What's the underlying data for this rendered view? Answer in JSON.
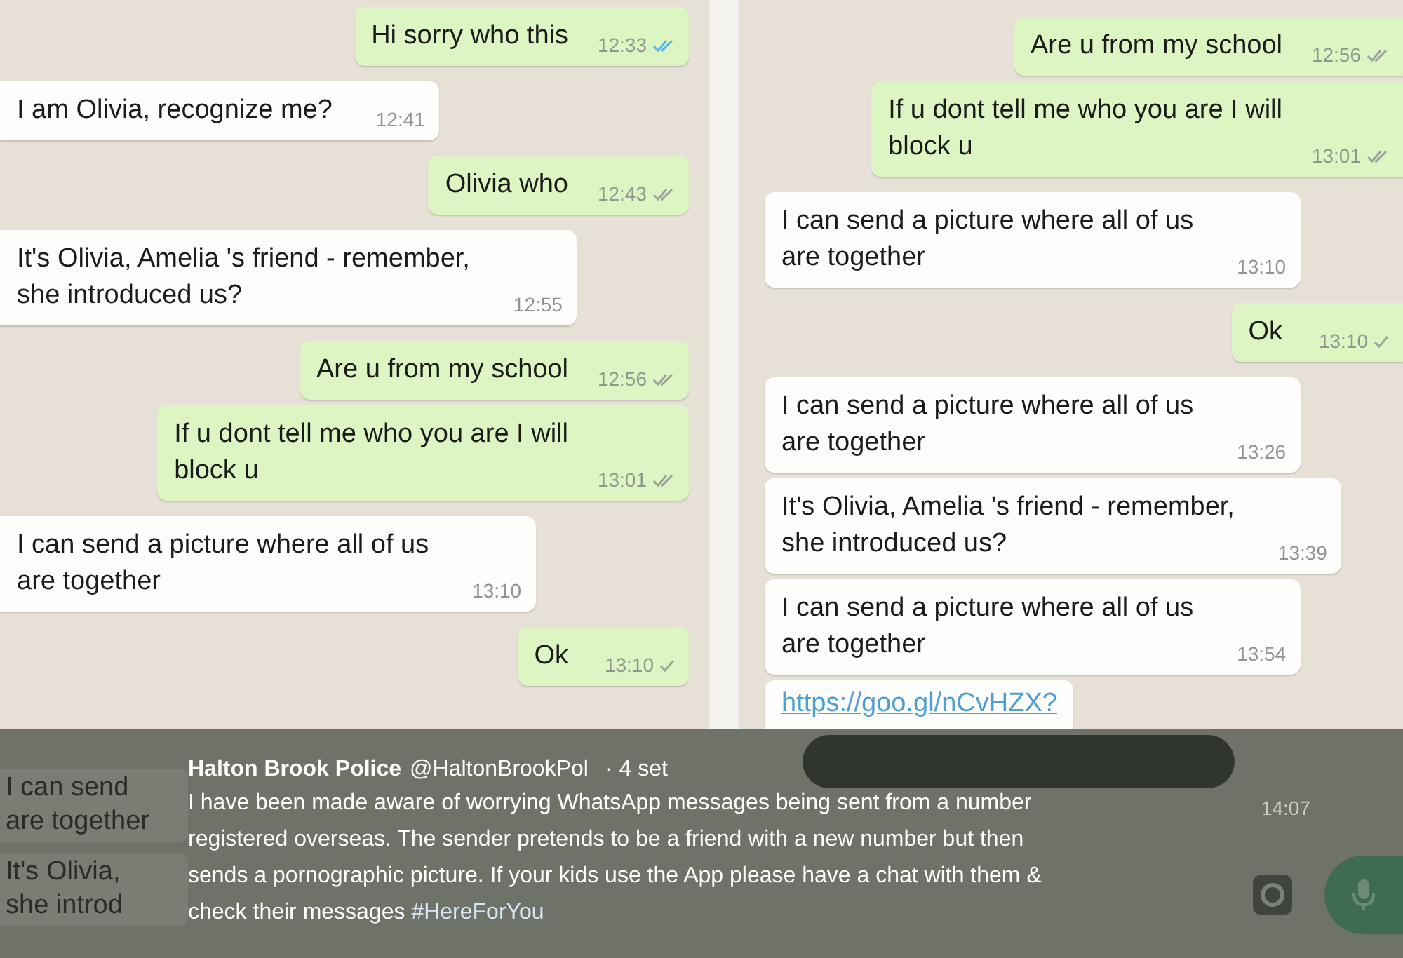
{
  "chats": [
    {
      "messages": [
        {
          "outgoing": true,
          "text": "Hi sorry who this",
          "time": "12:33",
          "double_tick": true,
          "read": true
        },
        {
          "outgoing": false,
          "text": "I am Olivia, recognize me?",
          "time": "12:41"
        },
        {
          "outgoing": true,
          "text": "Olivia who",
          "time": "12:43",
          "double_tick": true,
          "read": false
        },
        {
          "outgoing": false,
          "text": "It's Olivia, Amelia 's friend - remember,\nshe introduced us?",
          "time": "12:55"
        },
        {
          "outgoing": true,
          "text": "Are u from my school",
          "time": "12:56",
          "double_tick": true,
          "read": false
        },
        {
          "outgoing": true,
          "text": "If u dont tell me who you are I will\nblock u",
          "time": "13:01",
          "double_tick": true,
          "read": false
        },
        {
          "outgoing": false,
          "text": "I can send a picture where all of us\nare together",
          "time": "13:10"
        },
        {
          "outgoing": true,
          "text": "Ok",
          "time": "13:10",
          "double_tick": false,
          "read": false
        }
      ]
    },
    {
      "messages": [
        {
          "outgoing": true,
          "text": "Are u from my school",
          "time": "12:56",
          "double_tick": true,
          "read": false
        },
        {
          "outgoing": true,
          "text": "If u dont tell me who you are I will\nblock u",
          "time": "13:01",
          "double_tick": true,
          "read": false
        },
        {
          "outgoing": false,
          "text": "I can send a picture where all of us\nare together",
          "time": "13:10"
        },
        {
          "outgoing": true,
          "text": "Ok",
          "time": "13:10",
          "double_tick": false,
          "read": false
        },
        {
          "outgoing": false,
          "text": "I can send a picture where all of us\nare together",
          "time": "13:26"
        },
        {
          "outgoing": false,
          "text": "It's Olivia, Amelia 's friend - remember,\nshe introduced us?",
          "time": "13:39"
        },
        {
          "outgoing": false,
          "text": "I can send a picture where all of us\nare together",
          "time": "13:54"
        }
      ],
      "link": "https://goo.gl/nCvHZX?"
    }
  ],
  "covered_fragments": [
    {
      "lines": [
        "I can send",
        "are together"
      ]
    },
    {
      "lines": [
        "It's Olivia,",
        "she introd"
      ]
    }
  ],
  "covered_time": "14:07",
  "tweet": {
    "name": "Halton Brook Police",
    "handle": "@HaltonBrookPol",
    "age": "· 4 set",
    "body": "I have been made aware of worrying WhatsApp messages being sent from a number\nregistered overseas. The sender pretends to be a friend with a new number but then\nsends a pornographic picture. If your kids use the App please have a chat with them &\ncheck their messages",
    "hashtag": "#HereForYou"
  }
}
